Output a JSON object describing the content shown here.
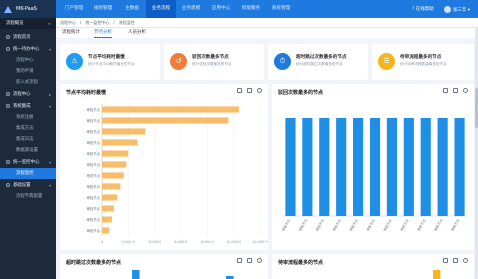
{
  "app": {
    "logo_text": "MK-PaaS"
  },
  "top_nav": {
    "tabs": [
      {
        "label": "门户管理"
      },
      {
        "label": "规则管理"
      },
      {
        "label": "主数据"
      },
      {
        "label": "业务流程"
      },
      {
        "label": "业务建模"
      },
      {
        "label": "应用中心"
      },
      {
        "label": "智能服务"
      },
      {
        "label": "系统管理"
      }
    ],
    "active_index": 3,
    "right": {
      "online_help": "在线帮助",
      "user": "张三丰"
    }
  },
  "sidebar": {
    "items": [
      {
        "label": "流程概览",
        "type": "header"
      },
      {
        "label": "流程首页",
        "type": "group"
      },
      {
        "label": "统一待办中心",
        "type": "group"
      },
      {
        "label": "流程中心",
        "type": "sub"
      },
      {
        "label": "我的申请",
        "type": "sub"
      },
      {
        "label": "嵌入式流程",
        "type": "sub"
      },
      {
        "label": "流程中心",
        "type": "group"
      },
      {
        "label": "系统集成",
        "type": "group"
      },
      {
        "label": "系统注册",
        "type": "sub"
      },
      {
        "label": "集成方法",
        "type": "sub"
      },
      {
        "label": "集成日志",
        "type": "sub"
      },
      {
        "label": "数据源设置",
        "type": "sub"
      },
      {
        "label": "统一监控中心",
        "type": "group"
      },
      {
        "label": "流程监控",
        "type": "sub-active"
      },
      {
        "label": "基础设置",
        "type": "group"
      },
      {
        "label": "流程字典配置",
        "type": "sub"
      }
    ]
  },
  "breadcrumb": [
    "流程中心",
    "统一监控中心",
    "流程监控"
  ],
  "subtabs": {
    "items": [
      "流程统计",
      "节点分析",
      "人员分析"
    ],
    "active_index": 1
  },
  "stat_cards": [
    {
      "title": "节点平均耗时最慢",
      "desc": "统计节点平均耗时最长的节点",
      "color": "#1f9cf0",
      "icon": "warning-icon",
      "glyph": "⚠"
    },
    {
      "title": "驳回次数最多节点",
      "desc": "统计驳回次数最多的节点",
      "color": "#f07d3a",
      "icon": "reject-icon",
      "glyph": "↺"
    },
    {
      "title": "超时跳过次数最多的节点",
      "desc": "统计超时跳过次数最多的节点",
      "color": "#1f7ae0",
      "icon": "timeout-icon",
      "glyph": "⏱"
    },
    {
      "title": "待审流程最多的节点",
      "desc": "统计待审流程数量最多的节点",
      "color": "#f5b51e",
      "icon": "pending-icon",
      "glyph": "☰"
    }
  ],
  "panels": [
    {
      "title": "节点平均耗时最慢"
    },
    {
      "title": "驳回次数最多的节点"
    },
    {
      "title": "超时跳过次数最多的节点"
    },
    {
      "title": "待审流程最多的节点"
    }
  ],
  "chart_data": [
    {
      "type": "bar",
      "orientation": "horizontal",
      "title": "节点平均耗时最慢",
      "categories": [
        "审批节点",
        "审批节点",
        "审批节点",
        "审批节点",
        "审批节点",
        "审批节点",
        "审批节点",
        "审批节点",
        "审批节点",
        "审批节点",
        "审批节点",
        "审批节点"
      ],
      "values": [
        10400,
        9600,
        3300,
        2700,
        2000,
        1850,
        1650,
        1400,
        1150,
        900,
        750,
        550
      ],
      "bar_color": "#f8bd6b",
      "xlim": [
        0,
        12000
      ],
      "xticks": [
        0,
        2000,
        4000,
        6000,
        8000,
        10000,
        12000
      ]
    },
    {
      "type": "bar",
      "title": "驳回次数最多的节点",
      "categories": [
        "审批节点",
        "审批节点",
        "审批节点",
        "审批节点",
        "审批节点",
        "审批节点",
        "审批节点",
        "审批节点",
        "审批节点",
        "审批节点",
        "审批节点"
      ],
      "values": [
        1,
        1,
        1,
        1,
        1,
        1,
        1,
        1,
        1,
        1,
        1
      ],
      "bar_color": "#1f8fe6",
      "ylim": [
        0,
        1
      ]
    },
    {
      "type": "bar",
      "title": "超时跳过次数最多的节点",
      "categories": [
        "",
        "",
        "",
        "",
        "",
        "",
        "",
        "",
        "",
        ""
      ],
      "values": [
        0.2,
        0,
        0,
        1,
        0,
        0,
        0,
        0,
        0.5,
        0
      ],
      "bar_color": "#1f8fe6"
    },
    {
      "type": "bar",
      "title": "待审流程最多的节点",
      "categories": [
        "",
        "",
        "",
        "",
        "",
        "",
        "",
        "",
        "",
        ""
      ],
      "values": [
        0,
        0,
        0,
        0,
        0,
        0,
        0,
        0,
        1,
        0
      ],
      "bar_color": "#f5b51e"
    }
  ]
}
